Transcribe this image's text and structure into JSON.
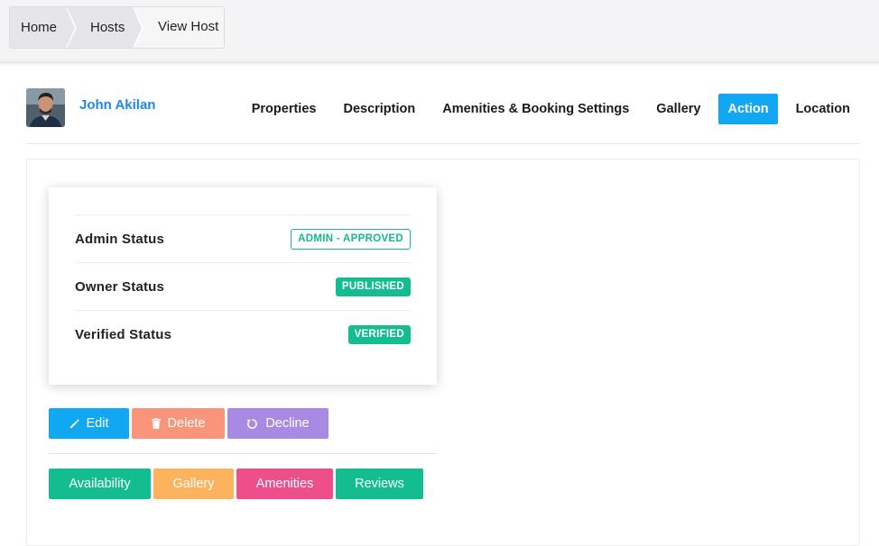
{
  "breadcrumb": {
    "items": [
      "Home",
      "Hosts"
    ],
    "current": "View Host"
  },
  "host": {
    "name": "John Akilan"
  },
  "tabs": [
    {
      "label": "Properties",
      "active": false
    },
    {
      "label": "Description",
      "active": false
    },
    {
      "label": "Amenities & Booking Settings",
      "active": false
    },
    {
      "label": "Gallery",
      "active": false
    },
    {
      "label": "Action",
      "active": true
    },
    {
      "label": "Location",
      "active": false
    }
  ],
  "statuses": [
    {
      "label": "Admin Status",
      "badge": "ADMIN - APPROVED",
      "style": "outline"
    },
    {
      "label": "Owner Status",
      "badge": "PUBLISHED",
      "style": "solid"
    },
    {
      "label": "Verified Status",
      "badge": "VERIFIED",
      "style": "solid"
    }
  ],
  "actions": {
    "edit": {
      "label": "Edit",
      "icon": "pencil-icon",
      "color": "#12a7f2"
    },
    "delete": {
      "label": "Delete",
      "icon": "trash-icon",
      "color": "#fa957a"
    },
    "decline": {
      "label": "Decline",
      "icon": "refresh-icon",
      "color": "#a98ae3"
    }
  },
  "links": {
    "availability": {
      "label": "Availability",
      "color": "#14bd90"
    },
    "gallery": {
      "label": "Gallery",
      "color": "#fdb25e"
    },
    "amenities": {
      "label": "Amenities",
      "color": "#ee4f8b"
    },
    "reviews": {
      "label": "Reviews",
      "color": "#14bd90"
    }
  },
  "colors": {
    "accent": "#12a7f2",
    "link": "#1e88e5",
    "success": "#14bd90"
  }
}
